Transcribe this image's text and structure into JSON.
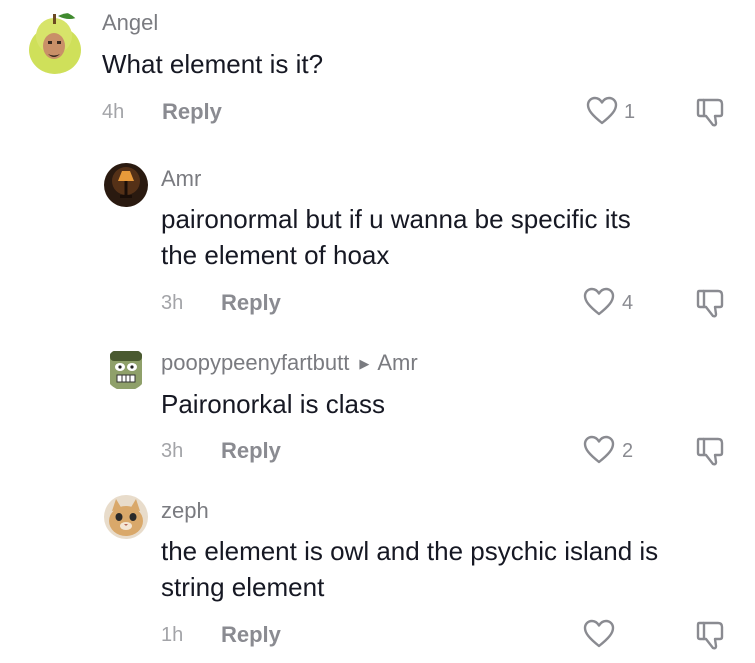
{
  "comments": [
    {
      "author": "Angel",
      "reply_to": "",
      "text_lines": [
        "What element is it?"
      ],
      "time": "4h",
      "reply_label": "Reply",
      "likes": "1",
      "avatar_icon": "pear-avatar"
    },
    {
      "author": "Amr",
      "reply_to": "",
      "text_lines": [
        "paironormal but if u wanna be specific its",
        "the element of hoax"
      ],
      "time": "3h",
      "reply_label": "Reply",
      "likes": "4",
      "avatar_icon": "lamp-avatar"
    },
    {
      "author": "poopypeenyfartbutt",
      "reply_to": "Amr",
      "text_lines": [
        "Paironorkal is class"
      ],
      "time": "3h",
      "reply_label": "Reply",
      "likes": "2",
      "avatar_icon": "cartoon-avatar"
    },
    {
      "author": "zeph",
      "reply_to": "",
      "text_lines": [
        "the element is owl and the psychic island is",
        "string element"
      ],
      "time": "1h",
      "reply_label": "Reply",
      "likes": "",
      "avatar_icon": "cat-avatar"
    }
  ]
}
